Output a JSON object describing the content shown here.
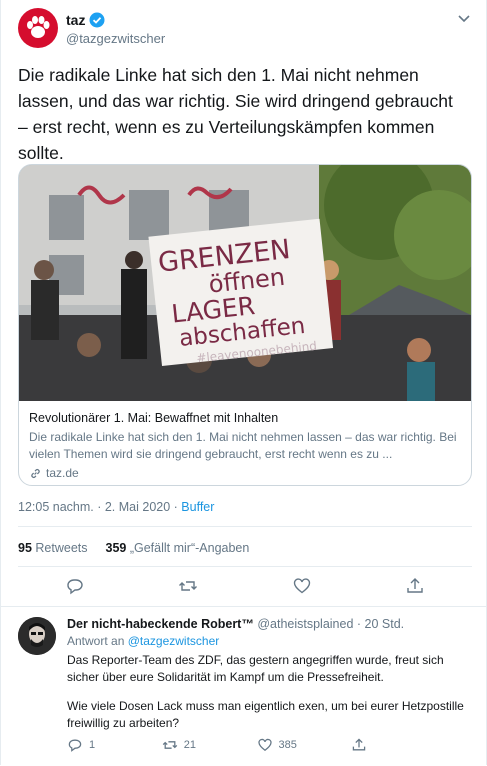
{
  "account": {
    "name": "taz",
    "handle": "@tazgezwitscher"
  },
  "tweet": {
    "text": "Die radikale Linke hat sich den 1. Mai nicht nehmen lassen, und das war richtig. Sie wird dringend gebraucht – erst recht, wenn es zu Verteilungskämpfen kommen sollte.",
    "time": "12:05 nachm. · 2. Mai 2020 · ",
    "source": "Buffer"
  },
  "card": {
    "sign_line1": "GRENZEN",
    "sign_line2": "öffnen",
    "sign_line3": "LAGER",
    "sign_line4": "abschaffen",
    "sign_line5": "#leavenoonebehind",
    "title": "Revolutionärer 1. Mai: Bewaffnet mit Inhalten",
    "description": "Die radikale Linke hat sich den 1. Mai nicht nehmen lassen – das war richtig. Bei vielen Themen wird sie dringend gebraucht, erst recht wenn es zu ...",
    "domain": "taz.de"
  },
  "stats": {
    "retweets_count": "95",
    "retweets_label": "Retweets",
    "likes_count": "359",
    "likes_label": "„Gefällt mir“-Angaben"
  },
  "reply": {
    "name": "Der nicht-habeckende Robert™",
    "handle": "@atheistsplained",
    "time": " · 20 Std.",
    "reply_to_prefix": "Antwort an ",
    "reply_to_handle": "@tazgezwitscher",
    "paragraph1": "Das Reporter-Team des ZDF, das gestern angegriffen wurde, freut sich sicher über eure Solidarität im Kampf um die Pressefreiheit.",
    "paragraph2": "Wie viele Dosen Lack muss man eigentlich exen, um bei eurer Hetzpostille freiwillig zu arbeiten?",
    "replies": "1",
    "retweets": "21",
    "likes": "385"
  },
  "colors": {
    "link": "#1b95e0",
    "muted": "#657786",
    "taz_red": "#d50d2e"
  }
}
